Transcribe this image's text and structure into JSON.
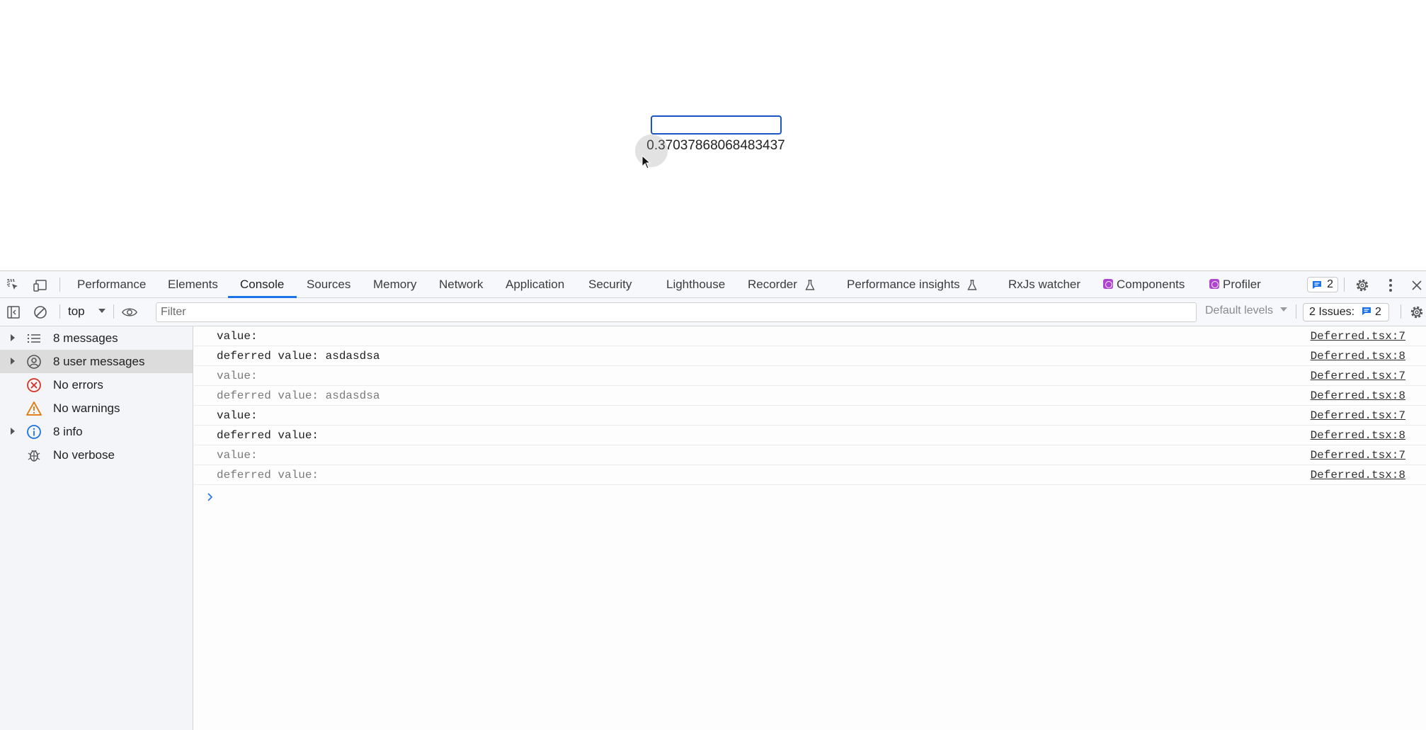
{
  "page": {
    "input_value": "",
    "random_value": "0.37037868068483437"
  },
  "devtools": {
    "tabs": [
      {
        "label": "Performance"
      },
      {
        "label": "Elements"
      },
      {
        "label": "Console",
        "active": true
      },
      {
        "label": "Sources"
      },
      {
        "label": "Memory"
      },
      {
        "label": "Network"
      },
      {
        "label": "Application"
      },
      {
        "label": "Security"
      },
      {
        "label": "Lighthouse"
      },
      {
        "label": "Recorder"
      },
      {
        "label": "Performance insights"
      },
      {
        "label": "RxJs watcher"
      },
      {
        "label": "Components"
      },
      {
        "label": "Profiler"
      }
    ],
    "message_badge_count": "2",
    "toolbar": {
      "context": "top",
      "filter_placeholder": "Filter",
      "levels": "Default levels",
      "issues_label": "2 Issues:",
      "issues_count": "2"
    },
    "sidebar": [
      {
        "label": "8 messages",
        "icon": "list-icon",
        "expandable": true
      },
      {
        "label": "8 user messages",
        "icon": "user-icon",
        "expandable": true,
        "selected": true
      },
      {
        "label": "No errors",
        "icon": "error-icon",
        "expandable": false
      },
      {
        "label": "No warnings",
        "icon": "warning-icon",
        "expandable": false
      },
      {
        "label": "8 info",
        "icon": "info-icon",
        "expandable": true
      },
      {
        "label": "No verbose",
        "icon": "bug-icon",
        "expandable": false
      }
    ],
    "messages": [
      {
        "text": "value:",
        "source": "Deferred.tsx:7",
        "dim": false
      },
      {
        "text": "deferred value: asdasdsa",
        "source": "Deferred.tsx:8",
        "dim": false
      },
      {
        "text": "value:",
        "source": "Deferred.tsx:7",
        "dim": true
      },
      {
        "text": "deferred value: asdasdsa",
        "source": "Deferred.tsx:8",
        "dim": true
      },
      {
        "text": "value:",
        "source": "Deferred.tsx:7",
        "dim": false
      },
      {
        "text": "deferred value:",
        "source": "Deferred.tsx:8",
        "dim": false
      },
      {
        "text": "value:",
        "source": "Deferred.tsx:7",
        "dim": true
      },
      {
        "text": "deferred value:",
        "source": "Deferred.tsx:8",
        "dim": true
      }
    ],
    "colors": {
      "accent": "#1a73e8",
      "error": "#d93025",
      "warning": "#e37400",
      "info": "#1a73e8",
      "react_badge": "#b043d1"
    }
  }
}
